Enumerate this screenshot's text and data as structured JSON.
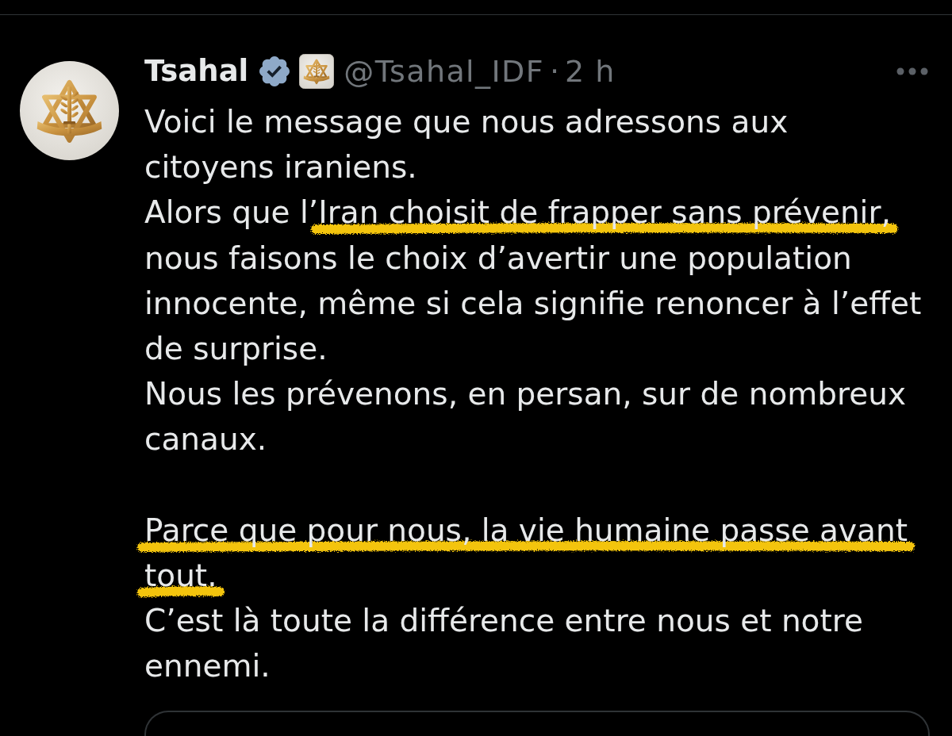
{
  "tweet": {
    "author": {
      "name": "Tsahal",
      "verified": true,
      "affiliated": true,
      "handle": "@Tsahal_IDF"
    },
    "separator": "·",
    "time": "2 h",
    "paragraphs": [
      {
        "lines": [
          {
            "segments": [
              {
                "text": "Voici le message que nous adressons aux citoyens iraniens.",
                "highlighted": false
              }
            ]
          },
          {
            "segments": [
              {
                "text": "Alors que l’",
                "highlighted": false
              },
              {
                "text": "Iran choisit de frapper sans prévenir,",
                "highlighted": true
              },
              {
                "text": " nous faisons le choix d’avertir une population innocente, même si cela signifie renoncer à l’effet de surprise.",
                "highlighted": false
              }
            ]
          },
          {
            "segments": [
              {
                "text": "Nous les prévenons, en persan, sur de nombreux canaux.",
                "highlighted": false
              }
            ]
          }
        ]
      },
      {
        "lines": [
          {
            "segments": [
              {
                "text": "Parce que pour nous, la vie humaine passe avant tout.",
                "highlighted": true
              }
            ]
          },
          {
            "segments": [
              {
                "text": "C’est là toute la différence entre nous et notre ennemi.",
                "highlighted": false
              }
            ]
          }
        ]
      }
    ],
    "embedded_card": true
  }
}
